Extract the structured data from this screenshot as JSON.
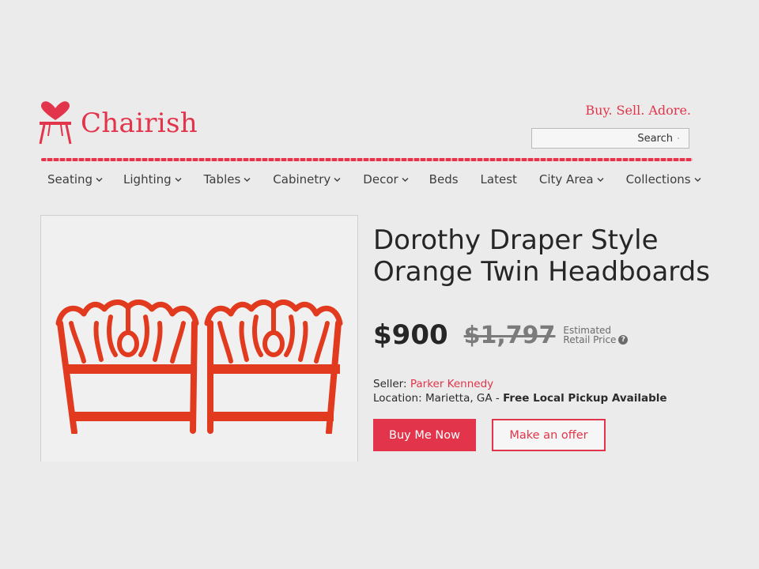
{
  "header": {
    "logo_text": "Chairish",
    "tagline": "Buy. Sell. Adore.",
    "search_placeholder": "Search",
    "brand_color": "#e2344a"
  },
  "nav": {
    "items": [
      {
        "label": "Seating",
        "has_dropdown": true
      },
      {
        "label": "Lighting",
        "has_dropdown": true
      },
      {
        "label": "Tables",
        "has_dropdown": true
      },
      {
        "label": "Cabinetry",
        "has_dropdown": true
      },
      {
        "label": "Decor",
        "has_dropdown": true
      },
      {
        "label": "Beds",
        "has_dropdown": false
      },
      {
        "label": "Latest",
        "has_dropdown": false
      },
      {
        "label": "City Area",
        "has_dropdown": true
      },
      {
        "label": "Collections",
        "has_dropdown": true
      }
    ]
  },
  "product": {
    "title": "Dorothy Draper Style Orange Twin Headboards",
    "price": "$900",
    "retail_price": "$1,797",
    "retail_label_line1": "Estimated",
    "retail_label_line2": "Retail Price",
    "help_glyph": "?",
    "seller_label": "Seller:",
    "seller_name": "Parker Kennedy",
    "location_label": "Location:",
    "location_value": "Marietta, GA -",
    "pickup_text": "Free Local Pickup Available",
    "image_color": "#e23a1f",
    "image_icon": "orange-twin-headboards"
  },
  "actions": {
    "buy_label": "Buy Me Now",
    "offer_label": "Make an offer"
  }
}
